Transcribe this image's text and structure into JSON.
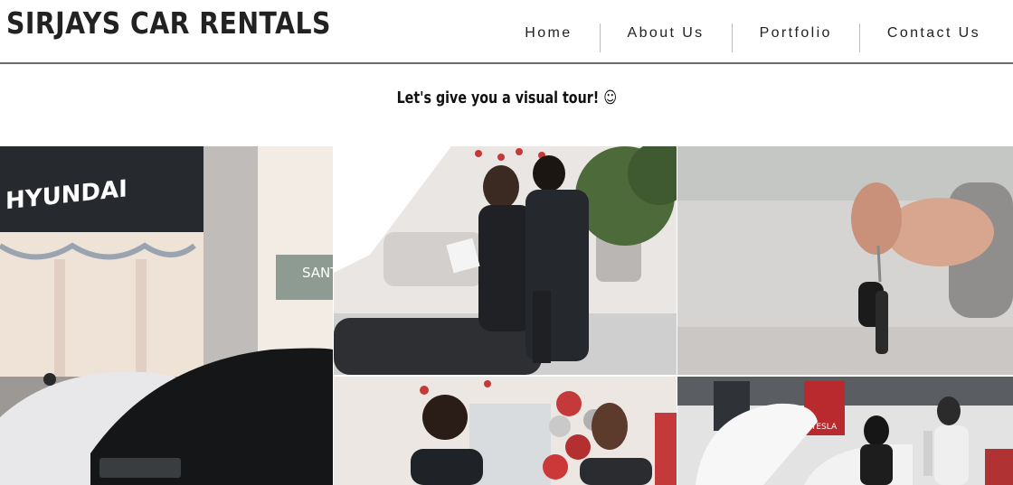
{
  "header": {
    "brand": "SIRJAYS CAR RENTALS",
    "nav": [
      {
        "label": "Home"
      },
      {
        "label": "About Us"
      },
      {
        "label": "Portfolio"
      },
      {
        "label": "Contact Us"
      }
    ]
  },
  "tagline": {
    "text": "Let's give you a visual tour! ☺"
  },
  "gallery": {
    "tiles": [
      {
        "sign_text": "HYUNDAI",
        "sign_text_2": "SANTI"
      },
      {
        "subject": "dealership-consultation"
      },
      {
        "subject": "car-key-handover"
      },
      {
        "subject": "sales-handshake"
      },
      {
        "sign_text": "TESLA"
      }
    ]
  },
  "colors": {
    "text": "#222222",
    "divider": "#6b6b6b",
    "nav_separator": "#bdbdbd"
  }
}
